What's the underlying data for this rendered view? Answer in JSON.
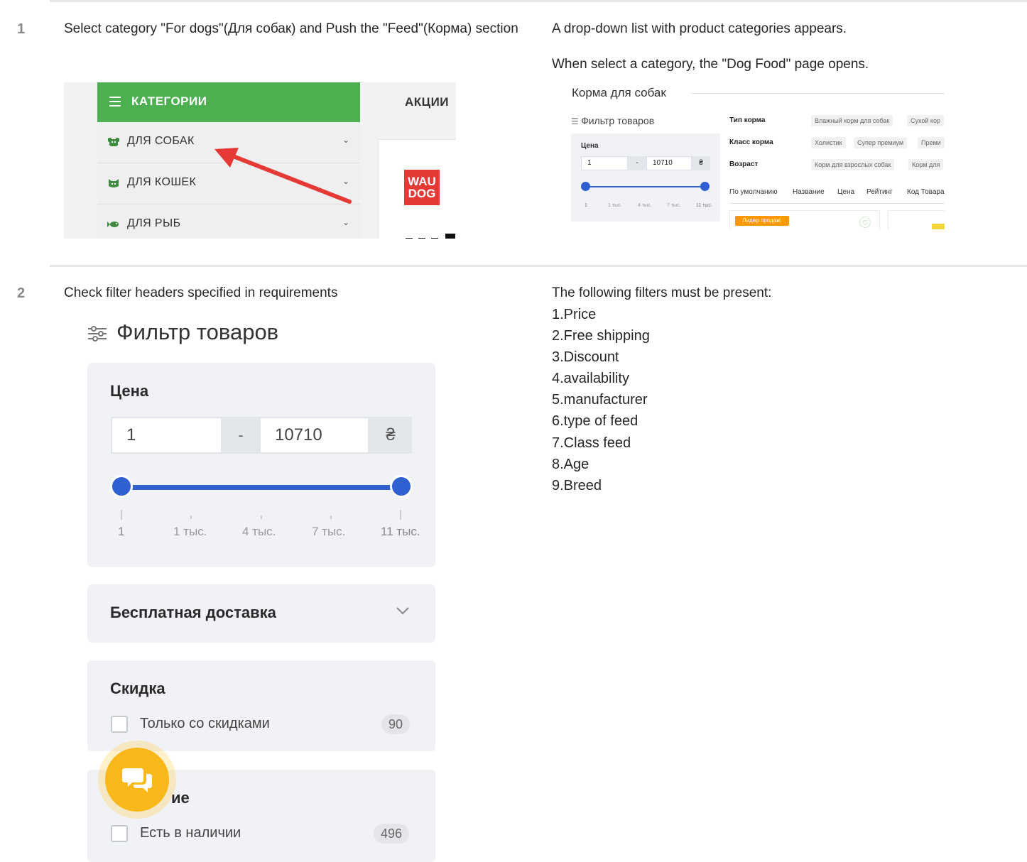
{
  "steps": [
    {
      "number": "1",
      "action": "Select category \"For dogs\"(Для собак) and  Push the \"Feed\"(Корма) section",
      "result_lines": [
        "A drop-down list with product categories appears.",
        "When select a category, the \"Dog Food\" page opens."
      ]
    },
    {
      "number": "2",
      "action": "Check filter headers specified in requirements",
      "result_intro": "The following filters must be present:",
      "filters": [
        "1.Price",
        "2.Free shipping",
        "3.Discount",
        "4.availability",
        "5.manufacturer",
        "6.type of feed",
        "7.Class feed",
        "8.Age",
        "9.Breed"
      ]
    }
  ],
  "categories_menu": {
    "header": "КАТЕГОРИИ",
    "promo_tab": "АКЦИИ",
    "items": [
      {
        "label": "ДЛЯ СОБАК",
        "icon": "dog-icon"
      },
      {
        "label": "ДЛЯ КОШЕК",
        "icon": "cat-icon"
      },
      {
        "label": "ДЛЯ РЫБ",
        "icon": "fish-icon"
      }
    ],
    "brand_logo_text": "WAU DOG",
    "annotation_color": "#e53935"
  },
  "dog_food_page": {
    "title": "Корма для собак",
    "filter_title": "Фильтр товаров",
    "price_label": "Цена",
    "price_min": "1",
    "price_sep": "-",
    "price_max": "10710",
    "currency": "₴",
    "ticks": [
      "1",
      "1 тыс.",
      "4 тыс.",
      "7 тыс.",
      "11 тыс."
    ],
    "filter_rows": [
      {
        "label": "Тип корма",
        "chips": [
          "Влажный корм для собак",
          "Сухой кор"
        ]
      },
      {
        "label": "Класс корма",
        "chips": [
          "Холистик",
          "Супер премиум",
          "Преми"
        ]
      },
      {
        "label": "Возраст",
        "chips": [
          "Корм для взрослых собак",
          "Корм для"
        ]
      }
    ],
    "sort_options": [
      "По умолчанию",
      "Название",
      "Цена",
      "Рейтинг",
      "Код Товара"
    ],
    "badge": "Лидер продаж!"
  },
  "filter_panel": {
    "title": "Фильтр товаров",
    "price": {
      "label": "Цена",
      "min": "1",
      "sep": "-",
      "max": "10710",
      "currency": "₴",
      "ticks": [
        "1",
        "1 тыс.",
        "4 тыс.",
        "7 тыс.",
        "11 тыс."
      ]
    },
    "free_shipping": {
      "label": "Бесплатная доставка"
    },
    "discount": {
      "label": "Скидка",
      "option": "Только со скидками",
      "count": "90"
    },
    "availability": {
      "label_visible": "ие",
      "option": "Есть в наличии",
      "count": "496"
    },
    "accent_color": "#2f5fd0",
    "chat_color": "#f9b81a"
  }
}
